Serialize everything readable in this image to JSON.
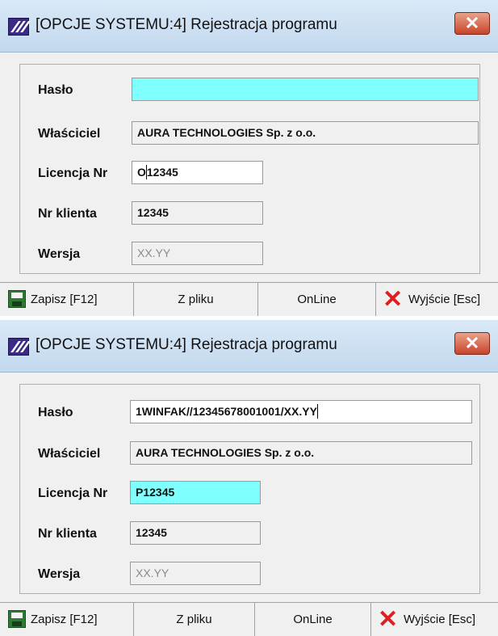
{
  "windows": [
    {
      "title": "[OPCJE SYSTEMU:4]  Rejestracja programu",
      "close_glyph": "✕",
      "fields": {
        "haslo": {
          "label": "Hasło",
          "value": ""
        },
        "wlasciciel": {
          "label": "Właściciel",
          "value": "AURA TECHNOLOGIES Sp. z o.o."
        },
        "licencja": {
          "label": "Licencja Nr",
          "value_before_caret": "O",
          "value_after_caret": "12345"
        },
        "nr_klienta": {
          "label": "Nr klienta",
          "value": "12345"
        },
        "wersja": {
          "label": "Wersja",
          "value": "XX.YY"
        }
      },
      "toolbar": {
        "save": "Zapisz  [F12]",
        "from_file": "Z pliku",
        "online": "OnLine",
        "exit": "Wyjście  [Esc]"
      }
    },
    {
      "title": "[OPCJE SYSTEMU:4]  Rejestracja programu",
      "close_glyph": "✕",
      "fields": {
        "haslo": {
          "label": "Hasło",
          "value": "1WINFAK//12345678001001/XX.YY"
        },
        "wlasciciel": {
          "label": "Właściciel",
          "value": "AURA TECHNOLOGIES Sp. z o.o."
        },
        "licencja": {
          "label": "Licencja Nr",
          "value": "P12345"
        },
        "nr_klienta": {
          "label": "Nr klienta",
          "value": "12345"
        },
        "wersja": {
          "label": "Wersja",
          "value": "XX.YY"
        }
      },
      "toolbar": {
        "save": "Zapisz  [F12]",
        "from_file": "Z pliku",
        "online": "OnLine",
        "exit": "Wyjście  [Esc]"
      }
    }
  ],
  "colors": {
    "focused_field": "#80ffff",
    "close_button": "#c8442a",
    "exit_icon": "#e01e1e",
    "save_icon": "#2d7a35"
  },
  "icons": {
    "app": "app-logo-icon",
    "close": "close-icon",
    "save": "floppy-disk-icon",
    "exit": "red-x-icon"
  }
}
